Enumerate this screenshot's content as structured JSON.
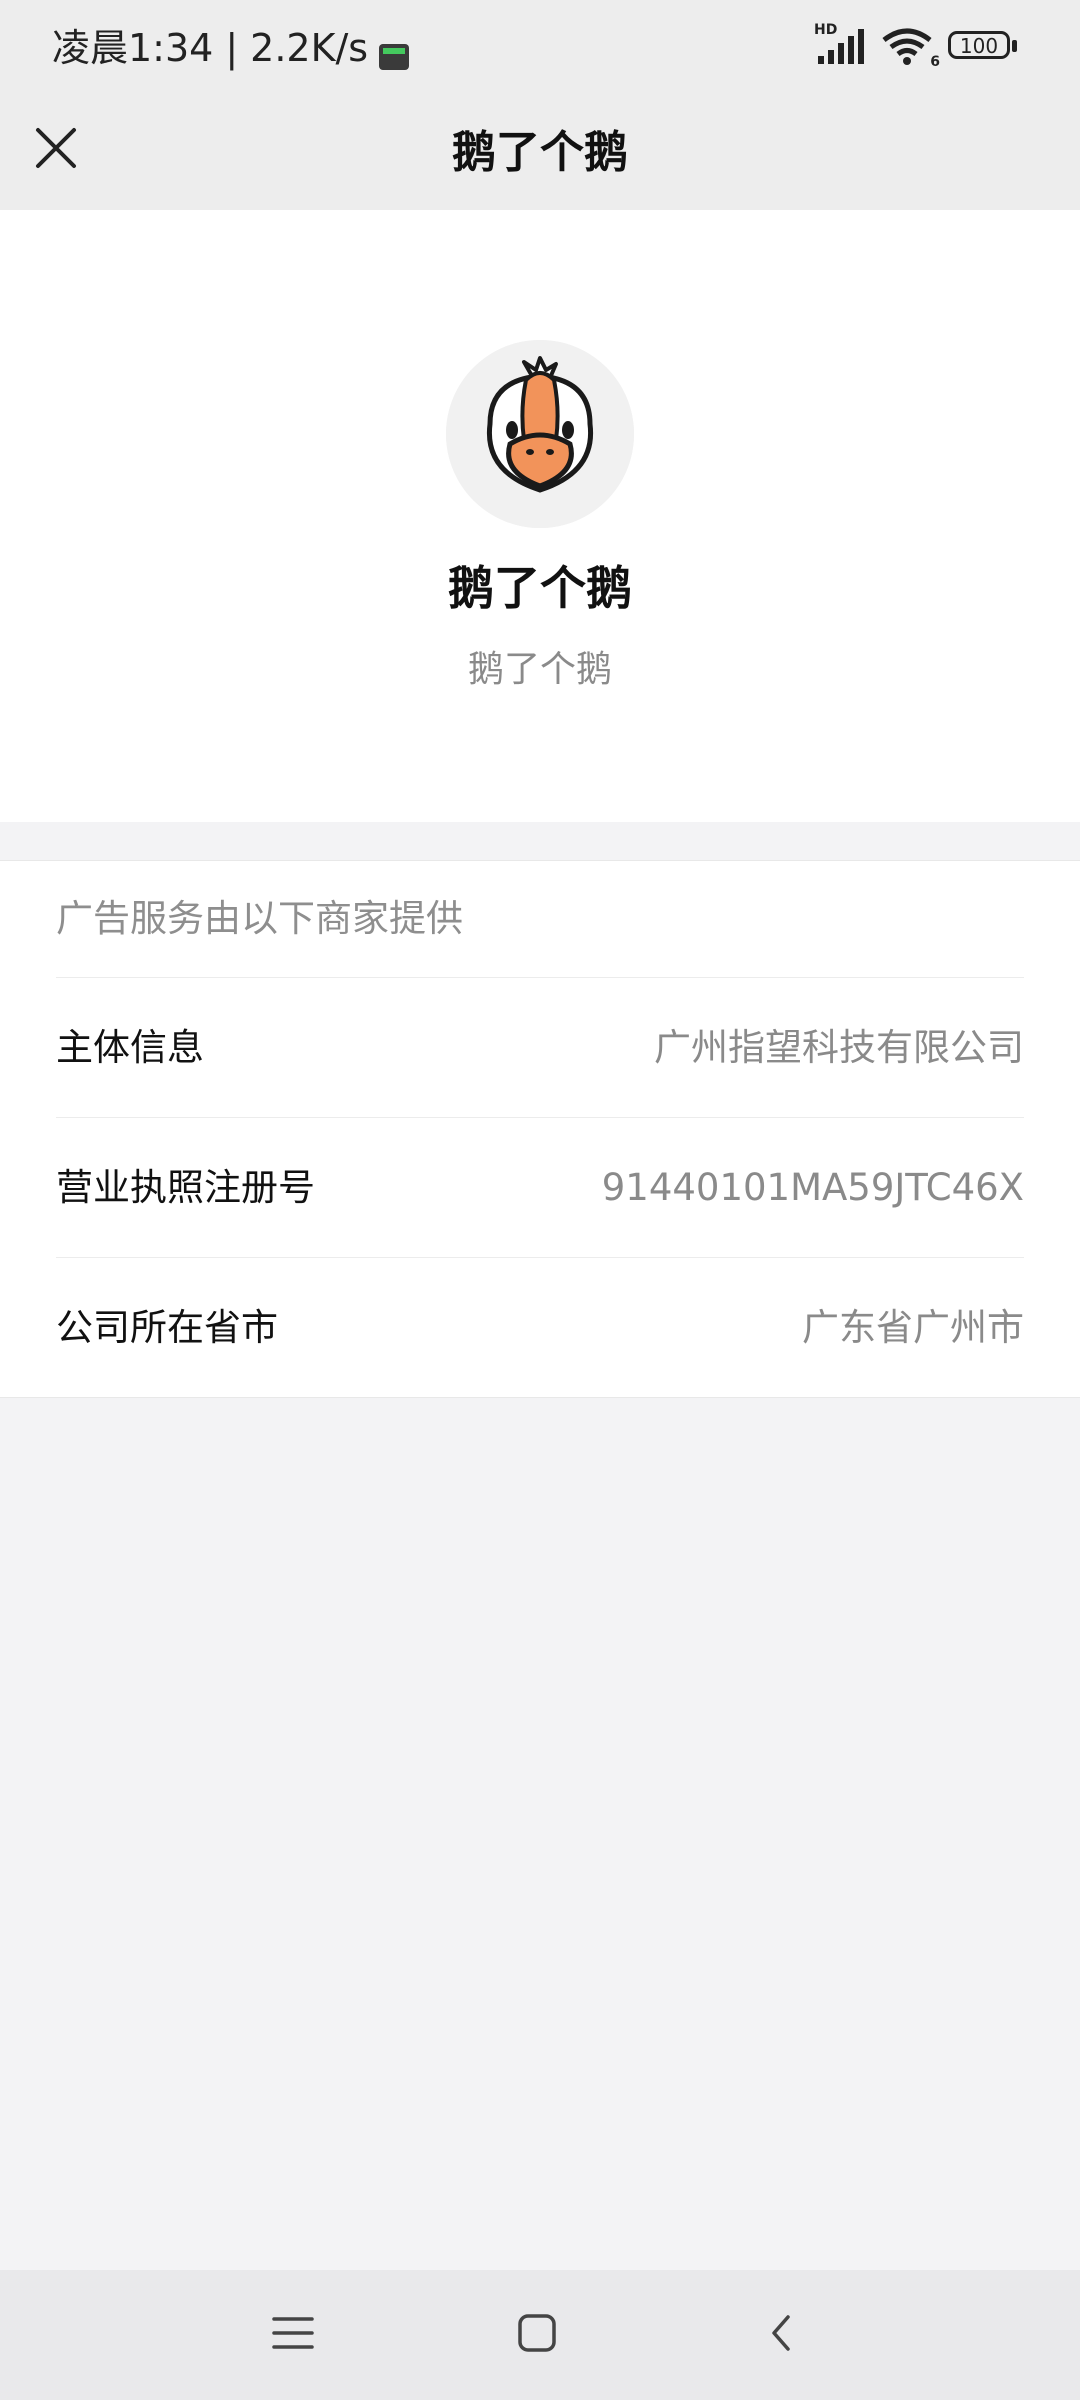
{
  "status_bar": {
    "time": "凌晨1:34",
    "separator": "|",
    "speed": "2.2K/s",
    "network_badge": "HD",
    "wifi_badge": "6",
    "battery": "100"
  },
  "nav": {
    "title": "鹅了个鹅"
  },
  "profile": {
    "name": "鹅了个鹅",
    "subtitle": "鹅了个鹅"
  },
  "info": {
    "header": "广告服务由以下商家提供",
    "rows": [
      {
        "label": "主体信息",
        "value": "广州指望科技有限公司"
      },
      {
        "label": "营业执照注册号",
        "value": "91440101MA59JTC46X"
      },
      {
        "label": "公司所在省市",
        "value": "广东省广州市"
      }
    ]
  },
  "icons": {
    "close": "close-icon",
    "menu": "menu-icon",
    "home": "home-icon",
    "back": "back-icon"
  },
  "colors": {
    "header_bg": "#ededed",
    "page_bg": "#f3f3f5",
    "card_bg": "#ffffff",
    "muted_text": "#8a8a8a",
    "goose_beak": "#f2935a"
  }
}
